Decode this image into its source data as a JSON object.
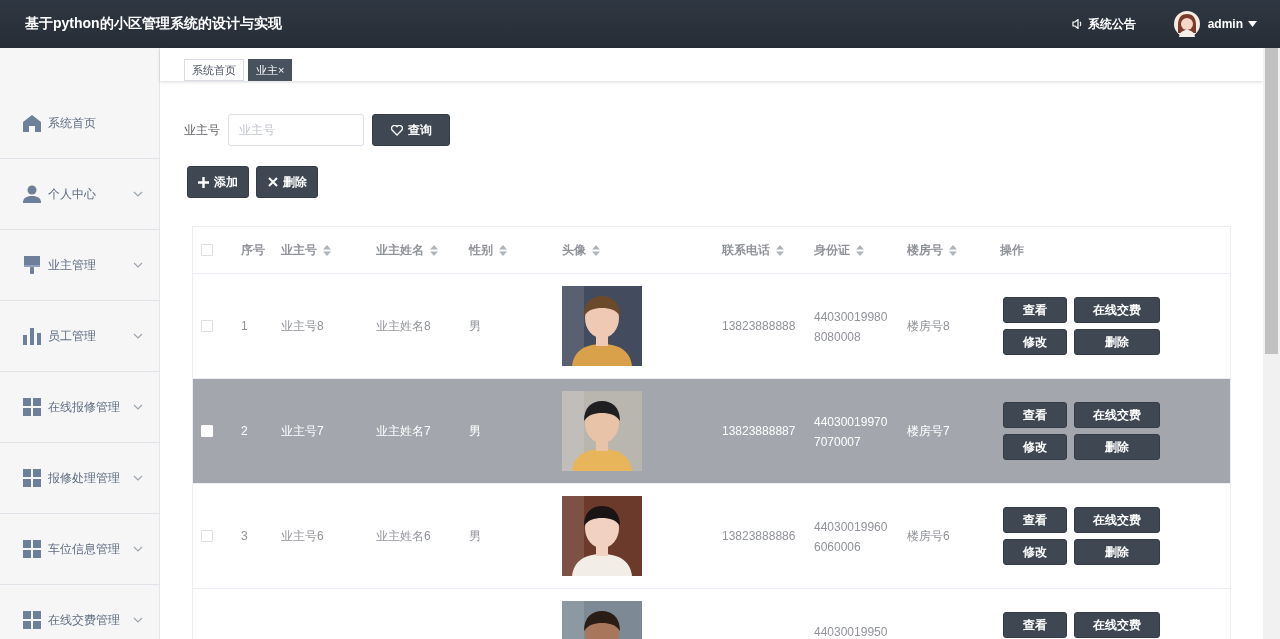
{
  "header": {
    "title": "基于python的小区管理系统的设计与实现",
    "notice": "系统公告",
    "user": "admin"
  },
  "sidebar": {
    "items": [
      {
        "label": "系统首页",
        "kind": "home",
        "has_submenu": false
      },
      {
        "label": "个人中心",
        "kind": "person",
        "has_submenu": true
      },
      {
        "label": "业主管理",
        "kind": "brush",
        "has_submenu": true
      },
      {
        "label": "员工管理",
        "kind": "chart",
        "has_submenu": true
      },
      {
        "label": "在线报修管理",
        "kind": "grid",
        "has_submenu": true
      },
      {
        "label": "报修处理管理",
        "kind": "grid",
        "has_submenu": true
      },
      {
        "label": "车位信息管理",
        "kind": "grid",
        "has_submenu": true
      },
      {
        "label": "在线交费管理",
        "kind": "grid",
        "has_submenu": true
      }
    ]
  },
  "tabs": [
    {
      "label": "系统首页",
      "selected": false
    },
    {
      "label": "业主",
      "close": "×",
      "selected": true
    }
  ],
  "search": {
    "label": "业主号",
    "placeholder": "业主号",
    "button": "查询"
  },
  "toolbar": [
    {
      "kind": "add",
      "label": "添加"
    },
    {
      "kind": "delete",
      "label": "删除"
    }
  ],
  "table": {
    "all_checked": false,
    "columns": [
      {
        "label": "序号",
        "sortable": false
      },
      {
        "label": "业主号",
        "sortable": true
      },
      {
        "label": "业主姓名",
        "sortable": true
      },
      {
        "label": "性别",
        "sortable": true
      },
      {
        "label": "头像",
        "sortable": true
      },
      {
        "label": "联系电话",
        "sortable": true
      },
      {
        "label": "身份证",
        "sortable": true
      },
      {
        "label": "楼房号",
        "sortable": true
      },
      {
        "label": "操作",
        "sortable": false
      }
    ],
    "rows": [
      {
        "selected": false,
        "index": "1",
        "owner_no": "业主号8",
        "owner_name": "业主姓名8",
        "gender": "男",
        "phone": "13823888888",
        "id_card": "440300199808080008",
        "building": "楼房号8",
        "actions": [
          "查看",
          "在线交费",
          "修改",
          "删除"
        ]
      },
      {
        "selected": true,
        "index": "2",
        "owner_no": "业主号7",
        "owner_name": "业主姓名7",
        "gender": "男",
        "phone": "13823888887",
        "id_card": "440300199707070007",
        "building": "楼房号7",
        "actions": [
          "查看",
          "在线交费",
          "修改",
          "删除"
        ]
      },
      {
        "selected": false,
        "index": "3",
        "owner_no": "业主号6",
        "owner_name": "业主姓名6",
        "gender": "男",
        "phone": "13823888886",
        "id_card": "440300199606060006",
        "building": "楼房号6",
        "actions": [
          "查看",
          "在线交费",
          "修改",
          "删除"
        ]
      },
      {
        "selected": false,
        "id_card": "44030019950",
        "actions": [
          "查看",
          "在线交费"
        ]
      }
    ]
  }
}
